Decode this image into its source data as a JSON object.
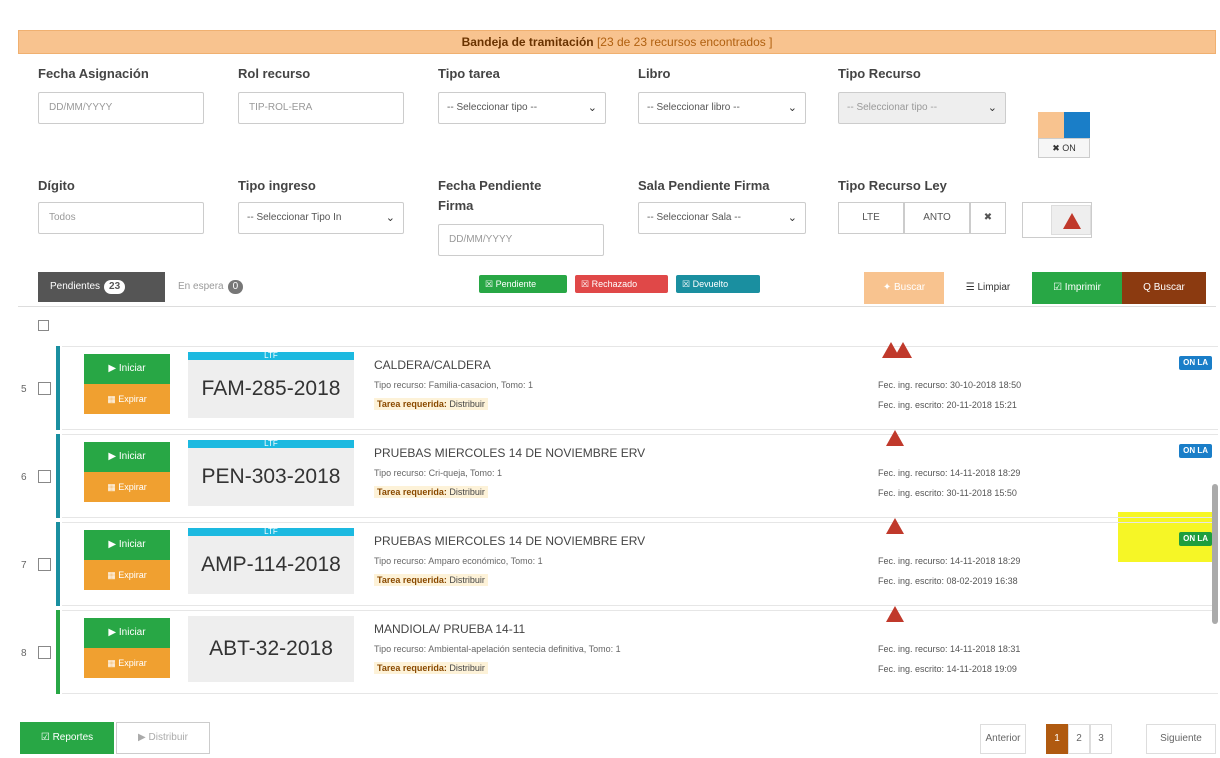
{
  "banner": {
    "title": "Bandeja de tramitación",
    "count": "[23 de 23 recursos encontrados ]"
  },
  "filters": {
    "fecha_asignacion": {
      "label": "Fecha Asignación",
      "placeholder": "DD/MM/YYYY"
    },
    "rol_recurso": {
      "label": "Rol recurso",
      "placeholder": "TIP-ROL-ERA"
    },
    "tipo_tarea": {
      "label": "Tipo tarea",
      "value": "-- Seleccionar tipo --"
    },
    "libro": {
      "label": "Libro",
      "value": "-- Seleccionar libro --"
    },
    "tipo_recurso": {
      "label": "Tipo Recurso",
      "value": "-- Seleccionar tipo --"
    },
    "on_label": "✖ ON",
    "digito": {
      "label": "Dígito",
      "placeholder": "Todos"
    },
    "tipo_ingreso": {
      "label": "Tipo ingreso",
      "value": "-- Seleccionar Tipo In"
    },
    "fecha_pendiente": {
      "label1": "Fecha Pendiente",
      "label2": "Firma",
      "placeholder": "DD/MM/YYYY"
    },
    "sala_pendiente": {
      "label": "Sala Pendiente Firma",
      "value": "-- Seleccionar Sala --"
    },
    "tipo_recurso_ley": {
      "label": "Tipo Recurso Ley",
      "opt1": "LTE",
      "opt2": "ANTO",
      "clear": "✖"
    }
  },
  "tabs": {
    "pendientes": "Pendientes",
    "pendientes_count": "23",
    "en_espera": "En espera",
    "en_espera_count": "0"
  },
  "legend": {
    "pendiente": "☒ Pendiente",
    "rechazado": "☒ Rechazado",
    "devuelto": "☒ Devuelto"
  },
  "buttons": {
    "buscar_prev": "✦ Buscar",
    "limpiar": "☰ Limpiar",
    "imprimir": "☑ Imprimir",
    "buscar": "Q Buscar"
  },
  "row_actions": {
    "iniciar": "▶ Iniciar",
    "expirar": "▦ Expirar"
  },
  "rows": [
    {
      "num": "5",
      "tipo": "LTF",
      "code": "FAM-285-2018",
      "title": "CALDERA/CALDERA",
      "sub": "Tipo recurso: Familia-casacion, Tomo: 1",
      "tarea_label": "Tarea requerida:",
      "tarea_value": "Distribuir",
      "fec1": "Fec. ing. recurso: 30-10-2018 18:50",
      "fec2": "Fec. ing. escrito: 20-11-2018 15:21",
      "badge": "ON LA",
      "color": "#1a8fa0"
    },
    {
      "num": "6",
      "tipo": "LTF",
      "code": "PEN-303-2018",
      "title": "PRUEBAS MIERCOLES 14 DE NOVIEMBRE ERV",
      "sub": "Tipo recurso: Cri-queja, Tomo: 1",
      "tarea_label": "Tarea requerida:",
      "tarea_value": "Distribuir",
      "fec1": "Fec. ing. recurso: 14-11-2018 18:29",
      "fec2": "Fec. ing. escrito: 30-11-2018 15:50",
      "badge": "ON LA",
      "color": "#1a8fa0"
    },
    {
      "num": "7",
      "tipo": "LTF",
      "code": "AMP-114-2018",
      "title": "PRUEBAS MIERCOLES 14 DE NOVIEMBRE ERV",
      "sub": "Tipo recurso: Amparo económico, Tomo: 1",
      "tarea_label": "Tarea requerida:",
      "tarea_value": "Distribuir",
      "fec1": "Fec. ing. recurso: 14-11-2018 18:29",
      "fec2": "Fec. ing. escrito: 08-02-2019 16:38",
      "badge": "ON LA",
      "color": "#1a8fa0"
    },
    {
      "num": "8",
      "tipo": "",
      "code": "ABT-32-2018",
      "title": "MANDIOLA/ PRUEBA 14-11",
      "sub": "Tipo recurso: Ambiental-apelación sentecia definitiva, Tomo: 1",
      "tarea_label": "Tarea requerida:",
      "tarea_value": "Distribuir",
      "fec1": "Fec. ing. recurso: 14-11-2018 18:31",
      "fec2": "Fec. ing. escrito: 14-11-2018 19:09",
      "badge": "",
      "color": "#28a745"
    }
  ],
  "footer": {
    "reportes": "☑ Reportes",
    "distribuir": "▶ Distribuir"
  },
  "pagination": {
    "prev": "Anterior",
    "p1": "1",
    "p2": "2",
    "p3": "3",
    "next": "Siguiente"
  }
}
